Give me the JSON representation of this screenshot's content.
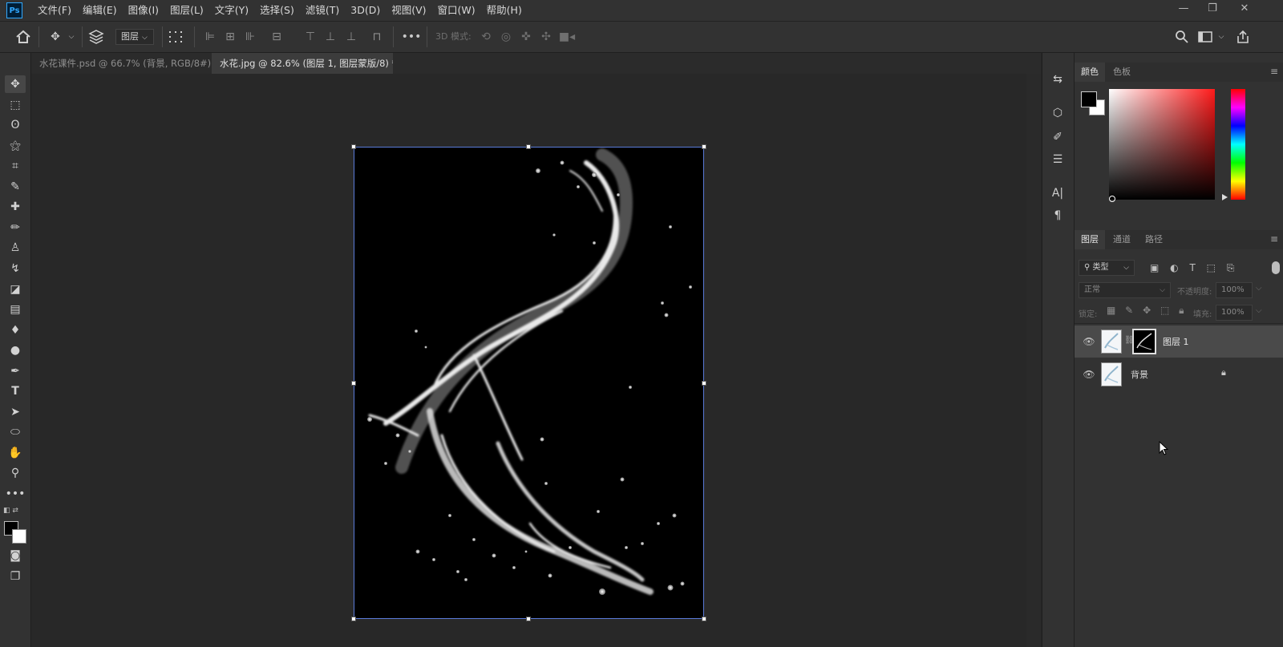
{
  "app": {
    "logo": "Ps"
  },
  "menu": [
    "文件(F)",
    "编辑(E)",
    "图像(I)",
    "图层(L)",
    "文字(Y)",
    "选择(S)",
    "滤镜(T)",
    "3D(D)",
    "视图(V)",
    "窗口(W)",
    "帮助(H)"
  ],
  "window_controls": {
    "minimize": "—",
    "restore": "❐",
    "close": "✕"
  },
  "options": {
    "auto_select_target": "图层",
    "mode_3d_label": "3D 模式:",
    "more": "•••"
  },
  "tabs": [
    {
      "label": "水花课件.psd @ 66.7% (背景, RGB/8#) *",
      "close": "×",
      "active": false
    },
    {
      "label": "水花.jpg @ 82.6% (图层 1, 图层蒙版/8) *",
      "close": "×",
      "active": true
    }
  ],
  "color_panel": {
    "tabs": [
      "颜色",
      "色板"
    ],
    "foreground": "#000000",
    "background": "#ffffff",
    "hue_color": "#ff1a1a"
  },
  "layers_panel": {
    "tabs": [
      "图层",
      "通道",
      "路径"
    ],
    "filter_label": "类型",
    "blend_mode": "正常",
    "opacity_label": "不透明度:",
    "opacity_value": "100%",
    "lock_label": "锁定:",
    "fill_label": "填充:",
    "fill_value": "100%",
    "layers": [
      {
        "name": "图层 1",
        "has_mask": true,
        "selected": true,
        "locked": false
      },
      {
        "name": "背景",
        "has_mask": false,
        "selected": false,
        "locked": true
      }
    ]
  },
  "colors": {
    "accent": "#31a8ff",
    "panel": "#323232",
    "canvas": "#282828",
    "selection": "#4a4a4a"
  }
}
